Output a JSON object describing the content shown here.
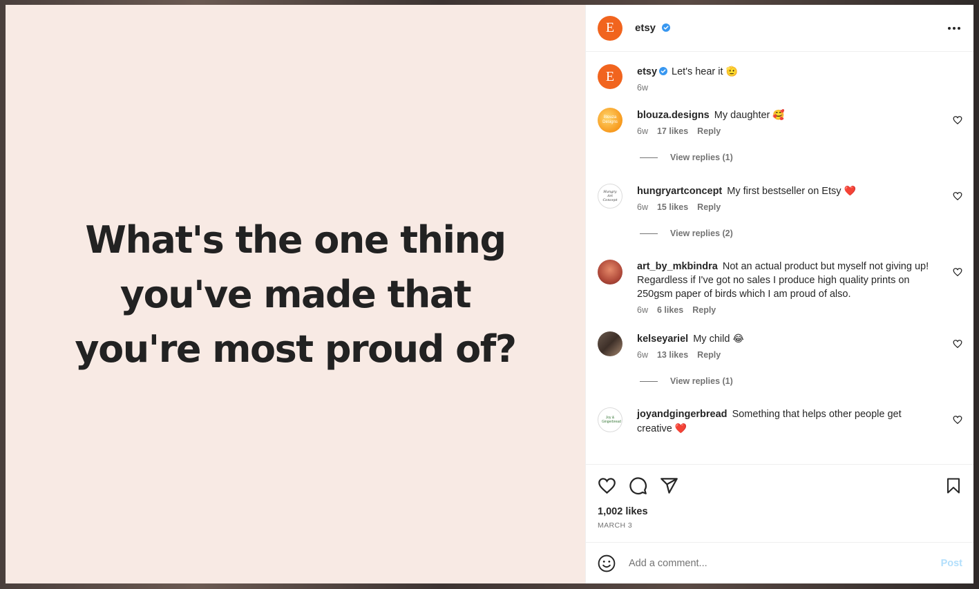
{
  "post": {
    "media_text": "What's the one thing you've made that you're most proud of?",
    "author": "etsy",
    "avatar_letter": "E",
    "caption": "Let's hear it",
    "caption_emoji": "🫡",
    "caption_time": "6w",
    "likes": "1,002 likes",
    "date": "MARCH 3"
  },
  "comments": [
    {
      "user": "blouza.designs",
      "text": "My daughter",
      "emoji": "🥰",
      "time": "6w",
      "likes": "17 likes",
      "reply": "Reply",
      "view_replies": "View replies (1)",
      "avatar_text": "Blouza Designs"
    },
    {
      "user": "hungryartconcept",
      "text": "My first bestseller on Etsy",
      "emoji": "❤️",
      "time": "6w",
      "likes": "15 likes",
      "reply": "Reply",
      "view_replies": "View replies (2)",
      "avatar_text": "Hungry Art Concept"
    },
    {
      "user": "art_by_mkbindra",
      "text": "Not an actual product but myself not giving up! Regardless if I've got no sales I produce high quality prints on 250gsm paper of birds which I am proud of also.",
      "emoji": "",
      "time": "6w",
      "likes": "6 likes",
      "reply": "Reply",
      "view_replies": ""
    },
    {
      "user": "kelseyariel",
      "text": "My child",
      "emoji": "😂",
      "time": "6w",
      "likes": "13 likes",
      "reply": "Reply",
      "view_replies": "View replies (1)"
    },
    {
      "user": "joyandgingerbread",
      "text": "Something that helps other people get creative",
      "emoji": "❤️",
      "time": "",
      "likes": "",
      "reply": "",
      "view_replies": "",
      "avatar_text": "Joy & Gingerbread"
    }
  ],
  "composer": {
    "placeholder": "Add a comment...",
    "post_label": "Post"
  },
  "icons": {
    "more": "more-horizontal-icon",
    "like": "heart-icon",
    "comment": "comment-icon",
    "share": "send-icon",
    "save": "bookmark-icon",
    "emoji": "smiley-icon",
    "verified": "verified-badge-icon"
  },
  "colors": {
    "etsy_orange": "#f1641e",
    "media_background": "#f8eae4",
    "verified_blue": "#3897f0",
    "post_disabled": "#b2dffc",
    "heart_red": "#ed1c3a"
  }
}
